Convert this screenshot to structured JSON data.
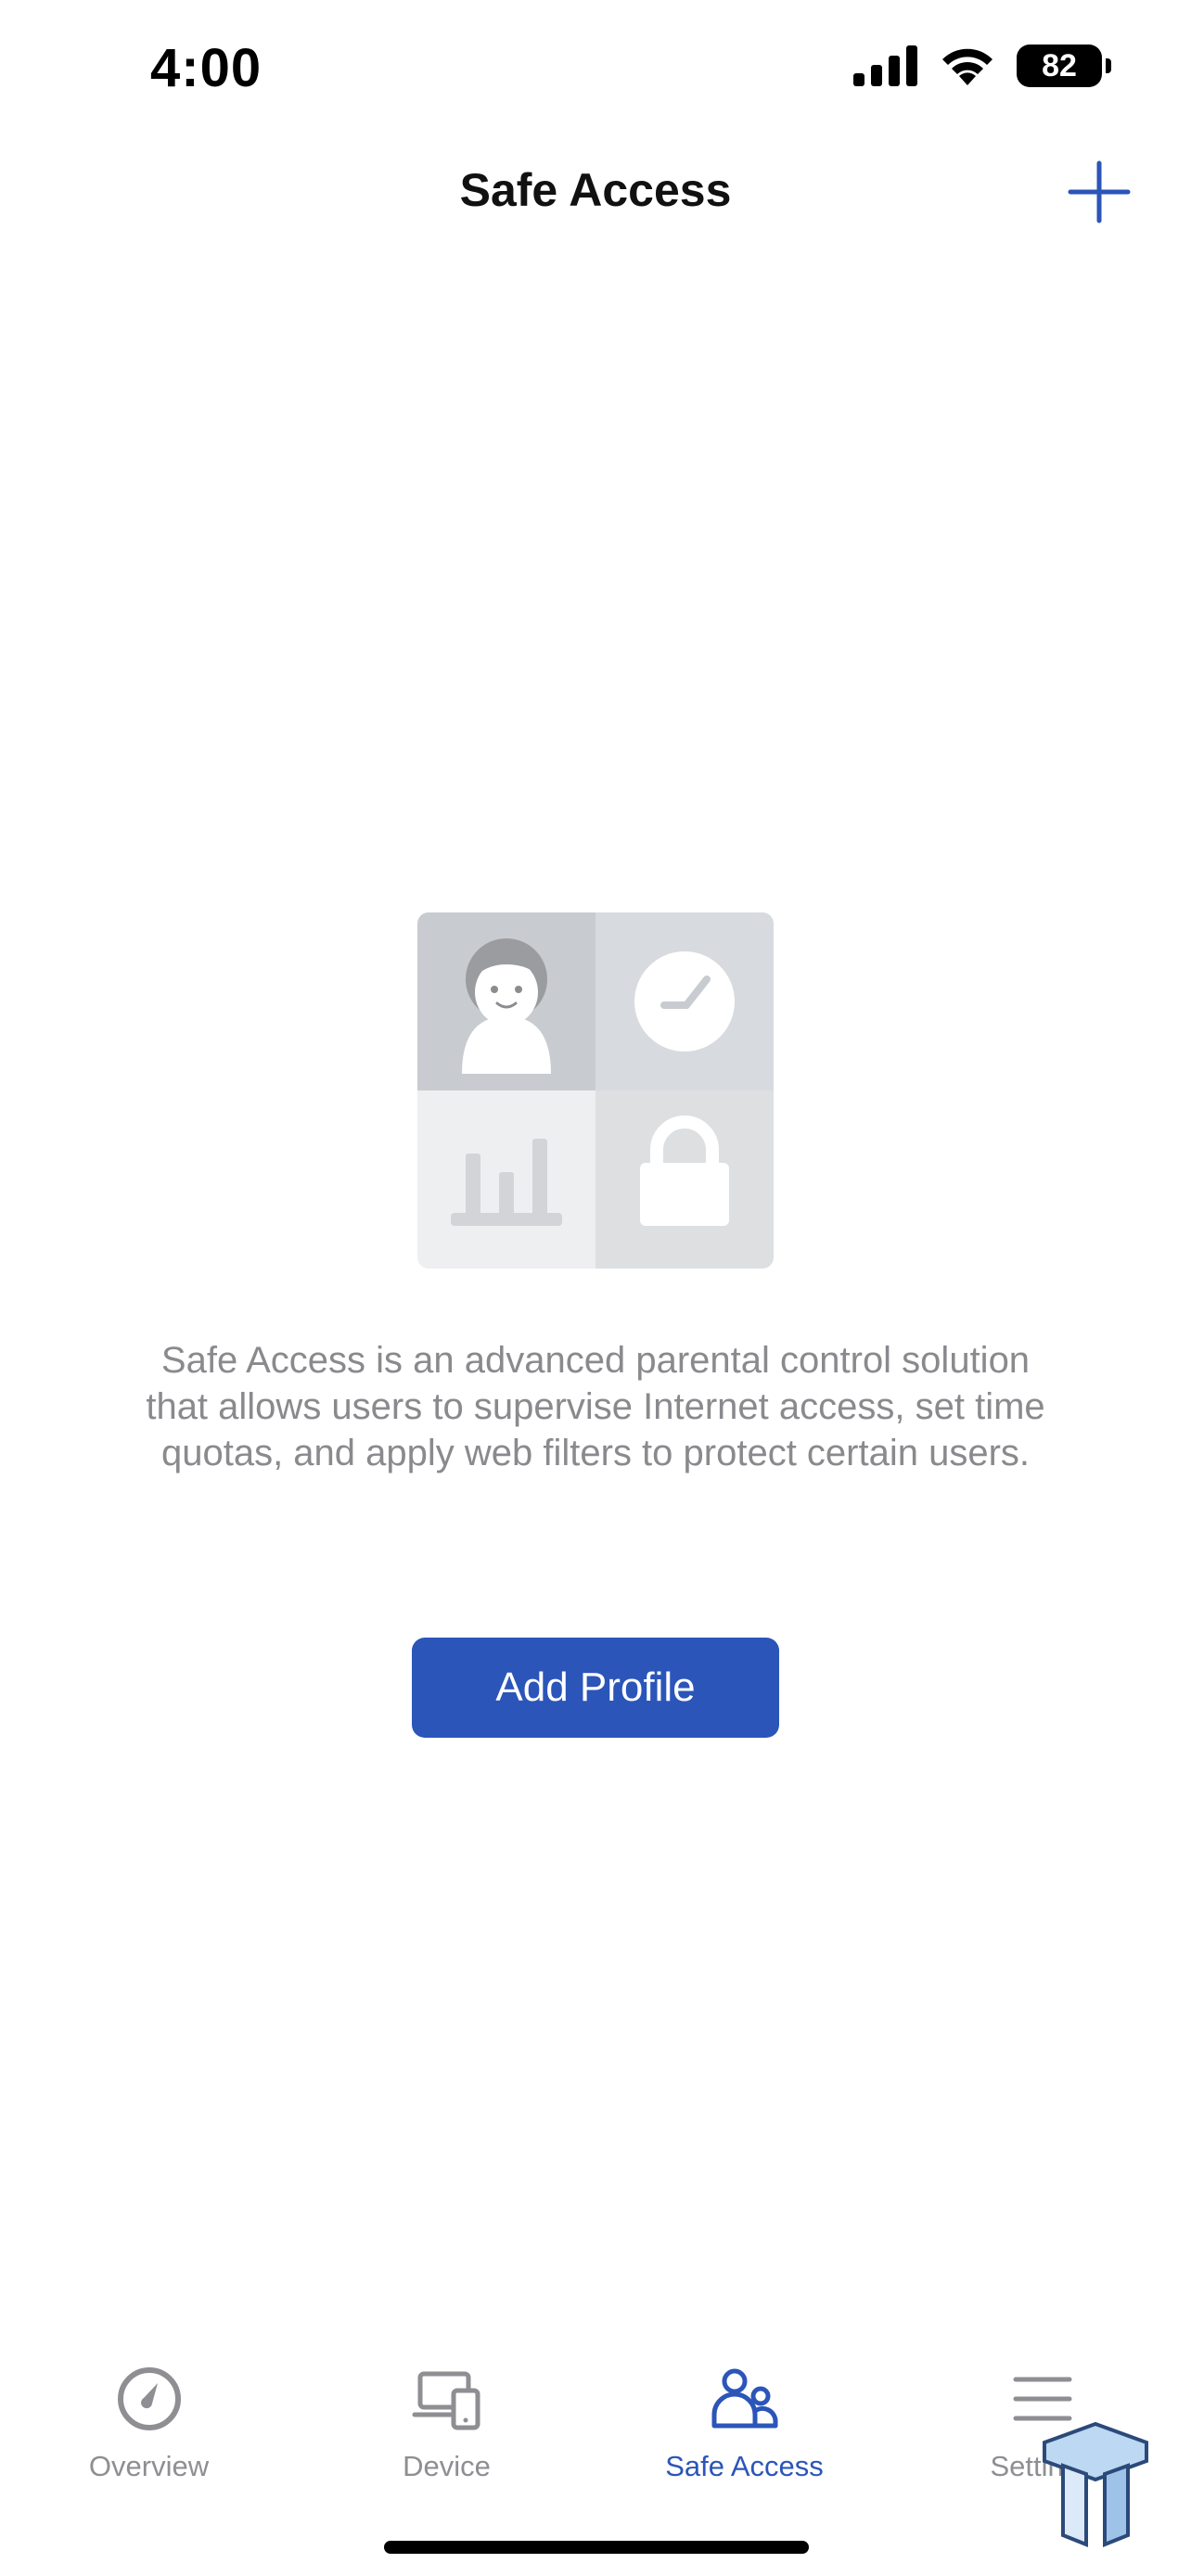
{
  "status_bar": {
    "time": "4:00",
    "battery": "82"
  },
  "nav": {
    "title": "Safe Access",
    "add_icon": "plus-icon"
  },
  "empty_state": {
    "illustration": "parental-control-illustration",
    "description": "Safe Access is an advanced parental control solution that allows users to supervise Internet access, set time quotas, and apply web filters to protect certain users.",
    "button_label": "Add Profile"
  },
  "tabs": [
    {
      "label": "Overview",
      "icon": "speedometer-icon",
      "active": false
    },
    {
      "label": "Device",
      "icon": "devices-icon",
      "active": false
    },
    {
      "label": "Safe Access",
      "icon": "users-icon",
      "active": true
    },
    {
      "label": "Settings",
      "icon": "menu-icon",
      "active": false
    }
  ],
  "colors": {
    "accent": "#2b55b9",
    "inactive": "#8e8e93",
    "description_text": "#8a8a8e"
  }
}
